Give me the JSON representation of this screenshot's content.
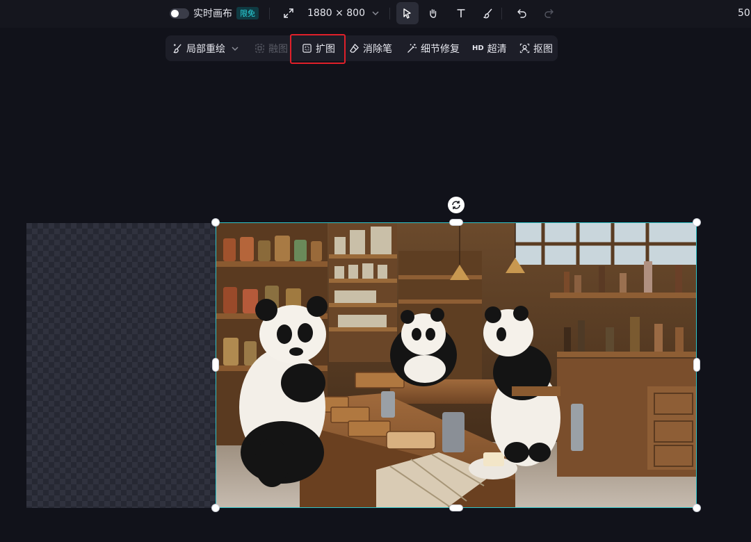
{
  "topbar": {
    "realtime_canvas_label": "实时画布",
    "limited_free_badge": "限免",
    "canvas_size": "1880 × 800",
    "zoom_text": "50"
  },
  "toolbar": {
    "inpaint_label": "局部重绘",
    "blend_label": "融图",
    "expand_label": "扩图",
    "eraser_label": "消除笔",
    "detail_fix_label": "细节修复",
    "hd_tag": "HD",
    "upscale_label": "超清",
    "cutout_label": "抠图"
  },
  "colors": {
    "accent_teal": "#2fc4c9",
    "highlight_red": "#e0202a",
    "badge_text": "#2ad6df"
  }
}
